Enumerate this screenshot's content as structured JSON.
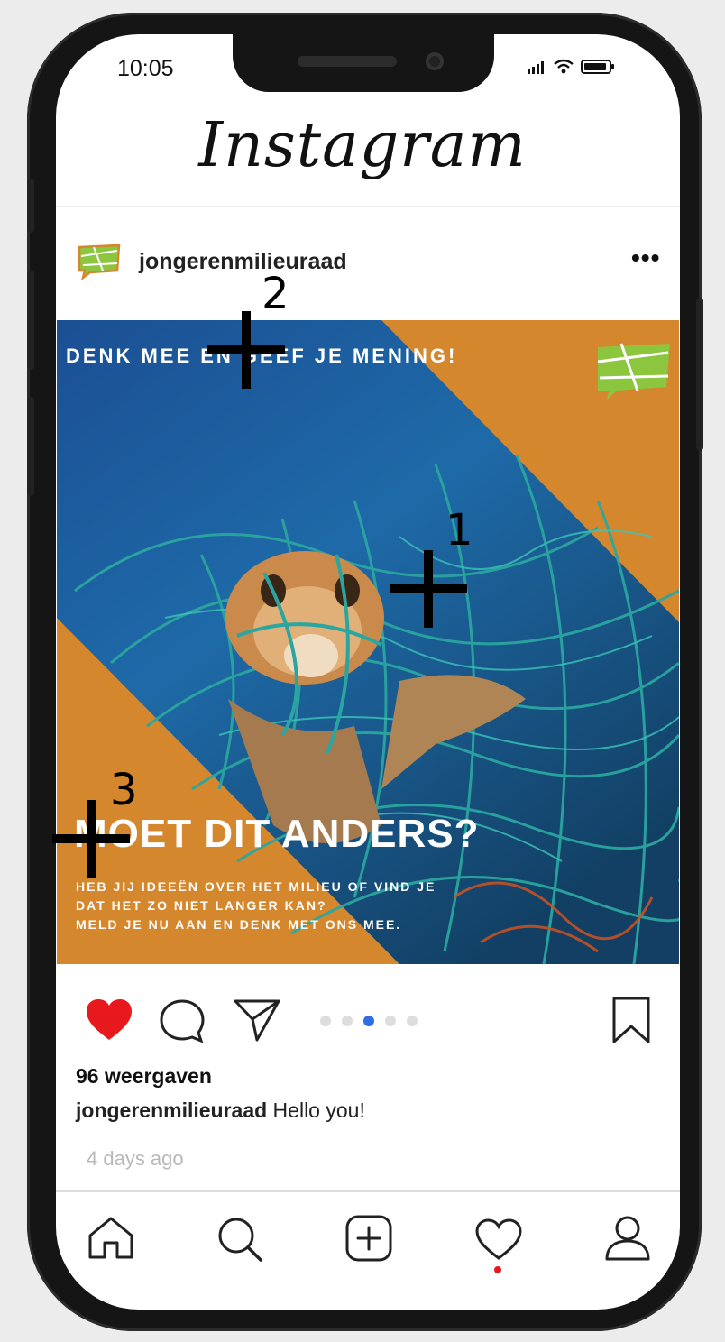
{
  "status_bar": {
    "time": "10:05"
  },
  "header": {
    "app_name": "Instagram"
  },
  "post": {
    "username": "jongerenmilieuraad",
    "more_label": "•••",
    "image": {
      "top_text": "DENK MEE EN GEEF JE MENING!",
      "headline": "MOET DIT ANDERS?",
      "sub_lines": [
        "HEB JIJ IDEEËN OVER HET MILIEU OF VIND JE",
        "DAT HET ZO NIET LANGER KAN?",
        "MELD JE NU AAN EN DENK MET ONS MEE."
      ]
    },
    "views": "96 weergaven",
    "caption_user": "jongerenmilieuraad",
    "caption_text": " Hello you!",
    "age": "4 days ago",
    "carousel": {
      "count": 5,
      "active_index": 2
    }
  },
  "markers": {
    "m1": "1",
    "m2": "2",
    "m3": "3"
  },
  "icons": [
    "heart-icon",
    "comment-icon",
    "share-icon",
    "bookmark-icon",
    "home-icon",
    "search-icon",
    "add-icon",
    "activity-icon",
    "profile-icon"
  ],
  "colors": {
    "accent_orange": "#d4872d",
    "like_red": "#e8191c",
    "active_dot": "#2d6ee6",
    "ocean_blue": "#1e5fa3",
    "net_teal": "#2aa6a0"
  }
}
